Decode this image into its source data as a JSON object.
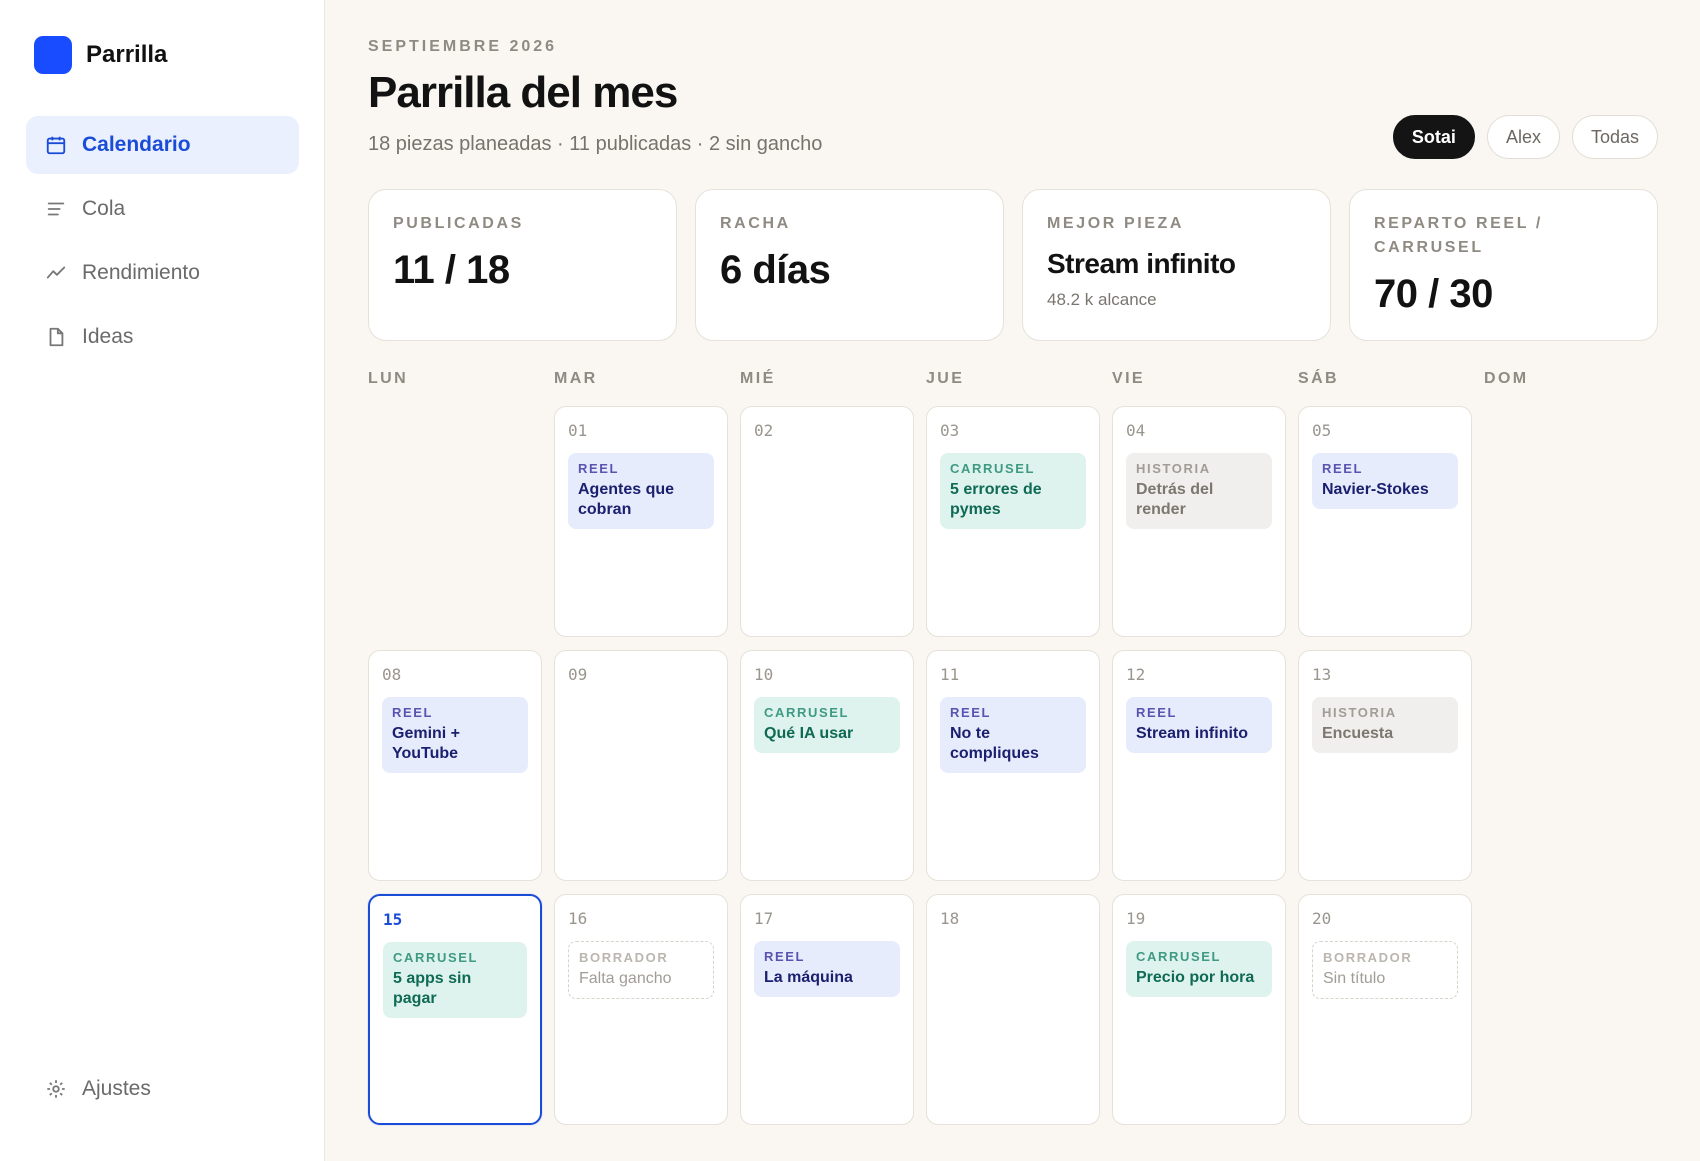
{
  "app": {
    "name": "Parrilla"
  },
  "sidebar": {
    "items": [
      {
        "label": "Calendario",
        "icon": "calendar-icon",
        "active": true
      },
      {
        "label": "Cola",
        "icon": "list-icon",
        "active": false
      },
      {
        "label": "Rendimiento",
        "icon": "trend-icon",
        "active": false
      },
      {
        "label": "Ideas",
        "icon": "document-icon",
        "active": false
      }
    ],
    "settings_label": "Ajustes"
  },
  "header": {
    "eyebrow": "SEPTIEMBRE 2026",
    "title": "Parrilla del mes",
    "subtitle": "18 piezas planeadas · 11 publicadas · 2 sin gancho"
  },
  "filters": [
    {
      "label": "Sotai",
      "active": true
    },
    {
      "label": "Alex",
      "active": false
    },
    {
      "label": "Todas",
      "active": false
    }
  ],
  "stats": {
    "publicadas": {
      "label": "PUBLICADAS",
      "value": "11 / 18"
    },
    "racha": {
      "label": "RACHA",
      "value": "6 días"
    },
    "mejor": {
      "label": "MEJOR PIEZA",
      "value": "Stream infinito",
      "sub": "48.2 k alcance"
    },
    "reparto": {
      "label": "REPARTO REEL / CARRUSEL",
      "value": "70 / 30"
    }
  },
  "weekdays": [
    "LUN",
    "MAR",
    "MIÉ",
    "JUE",
    "VIE",
    "SÁB",
    "DOM"
  ],
  "calendar": {
    "today": "15",
    "weeks": [
      [
        null,
        {
          "day": "01",
          "card": {
            "type": "reel",
            "kind": "REEL",
            "title": "Agentes que cobran"
          }
        },
        {
          "day": "02"
        },
        {
          "day": "03",
          "card": {
            "type": "carrusel",
            "kind": "CARRUSEL",
            "title": "5 errores de pymes"
          }
        },
        {
          "day": "04",
          "card": {
            "type": "historia",
            "kind": "HISTORIA",
            "title": "Detrás del render"
          }
        },
        {
          "day": "05",
          "card": {
            "type": "reel",
            "kind": "REEL",
            "title": "Navier-Stokes"
          }
        },
        null
      ],
      [
        {
          "day": "08",
          "card": {
            "type": "reel",
            "kind": "REEL",
            "title": "Gemini + YouTube"
          }
        },
        {
          "day": "09"
        },
        {
          "day": "10",
          "card": {
            "type": "carrusel",
            "kind": "CARRUSEL",
            "title": "Qué IA usar"
          }
        },
        {
          "day": "11",
          "card": {
            "type": "reel",
            "kind": "REEL",
            "title": "No te compliques"
          }
        },
        {
          "day": "12",
          "card": {
            "type": "reel",
            "kind": "REEL",
            "title": "Stream infinito"
          }
        },
        {
          "day": "13",
          "card": {
            "type": "historia",
            "kind": "HISTORIA",
            "title": "Encuesta"
          }
        },
        null
      ],
      [
        {
          "day": "15",
          "card": {
            "type": "carrusel",
            "kind": "CARRUSEL",
            "title": "5 apps sin pagar"
          }
        },
        {
          "day": "16",
          "card": {
            "type": "borrador",
            "kind": "BORRADOR",
            "title": "Falta gancho"
          }
        },
        {
          "day": "17",
          "card": {
            "type": "reel",
            "kind": "REEL",
            "title": "La máquina"
          }
        },
        {
          "day": "18"
        },
        {
          "day": "19",
          "card": {
            "type": "carrusel",
            "kind": "CARRUSEL",
            "title": "Precio por hora"
          }
        },
        {
          "day": "20",
          "card": {
            "type": "borrador",
            "kind": "BORRADOR",
            "title": "Sin título"
          }
        },
        null
      ]
    ]
  },
  "colors": {
    "accent": "#1a4cd8",
    "brand": "#1a4cff",
    "reel_bg": "#e7ecfd",
    "carrusel_bg": "#dff3ee",
    "historia_bg": "#f0efed"
  }
}
